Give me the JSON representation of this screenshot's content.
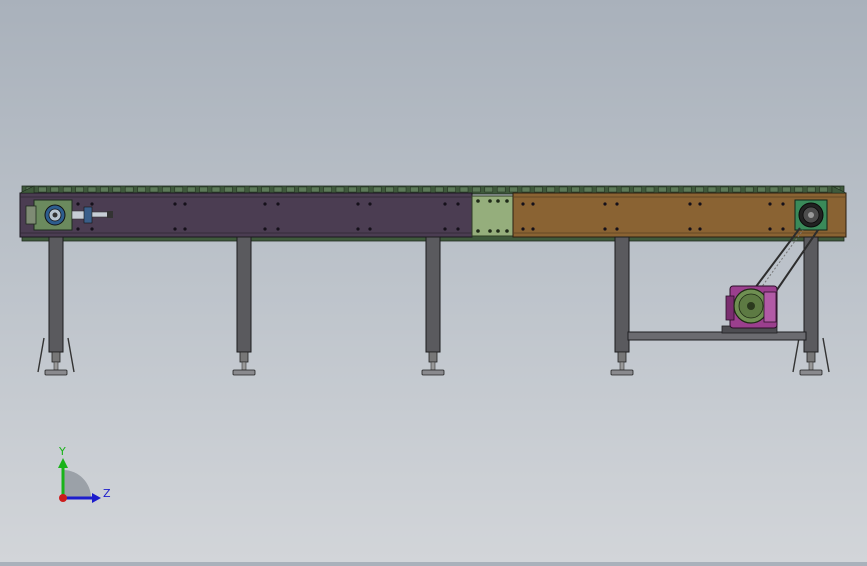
{
  "viewport": {
    "background_top": "#a9b1bb",
    "background_bottom": "#d2d5d9"
  },
  "model": {
    "frame_left_color": "#4b3d52",
    "frame_right_color": "#8a6333",
    "splice_plate_color": "#95ae7c",
    "motor_color": "#9b3f8e",
    "leg_color": "#5a5a5e"
  },
  "triad": {
    "y_label": "Y",
    "z_label": "Z",
    "y_color": "#19b319",
    "z_color": "#1c1ccc",
    "origin_color": "#cc1c1c"
  }
}
